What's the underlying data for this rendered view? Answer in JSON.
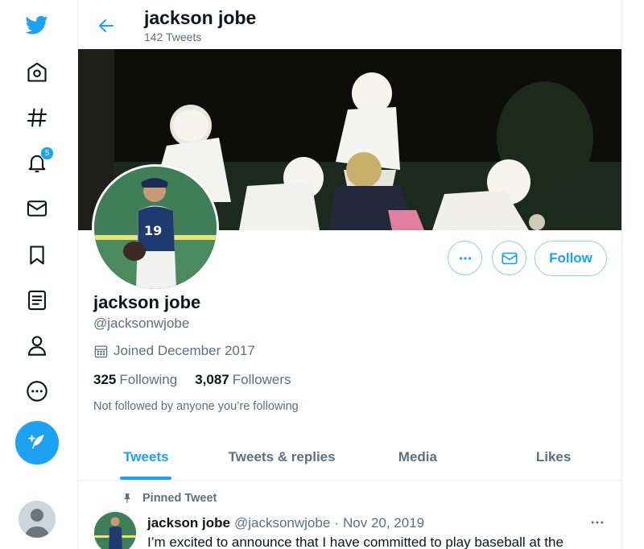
{
  "header": {
    "name": "jackson jobe",
    "tweet_count": "142 Tweets"
  },
  "nav": {
    "notification_count": "5",
    "items": [
      "twitter-logo",
      "home-icon",
      "explore-hash-icon",
      "notifications-bell-icon",
      "messages-mail-icon",
      "bookmark-icon",
      "lists-icon",
      "profile-icon",
      "more-icon",
      "compose-tweet-icon"
    ]
  },
  "profile": {
    "name": "jackson jobe",
    "handle": "@jacksonwjobe",
    "joined": "Joined December 2017",
    "following_count": "325",
    "following_label": "Following",
    "followers_count": "3,087",
    "followers_label": "Followers",
    "not_followed": "Not followed by anyone you’re following",
    "follow_label": "Follow"
  },
  "tabs": [
    {
      "label": "Tweets",
      "active": true
    },
    {
      "label": "Tweets & replies",
      "active": false
    },
    {
      "label": "Media",
      "active": false
    },
    {
      "label": "Likes",
      "active": false
    }
  ],
  "pinned_tweet": {
    "pinned_label": "Pinned Tweet",
    "name": "jackson jobe",
    "handle": "@jacksonwjobe",
    "separator": "·",
    "date": "Nov 20, 2019",
    "text": "I’m excited to announce that I have committed to play baseball at the"
  },
  "colors": {
    "accent": "#1da1f2",
    "text_primary": "#0f1419",
    "text_secondary": "#5b7083",
    "border": "#ebeef0"
  }
}
